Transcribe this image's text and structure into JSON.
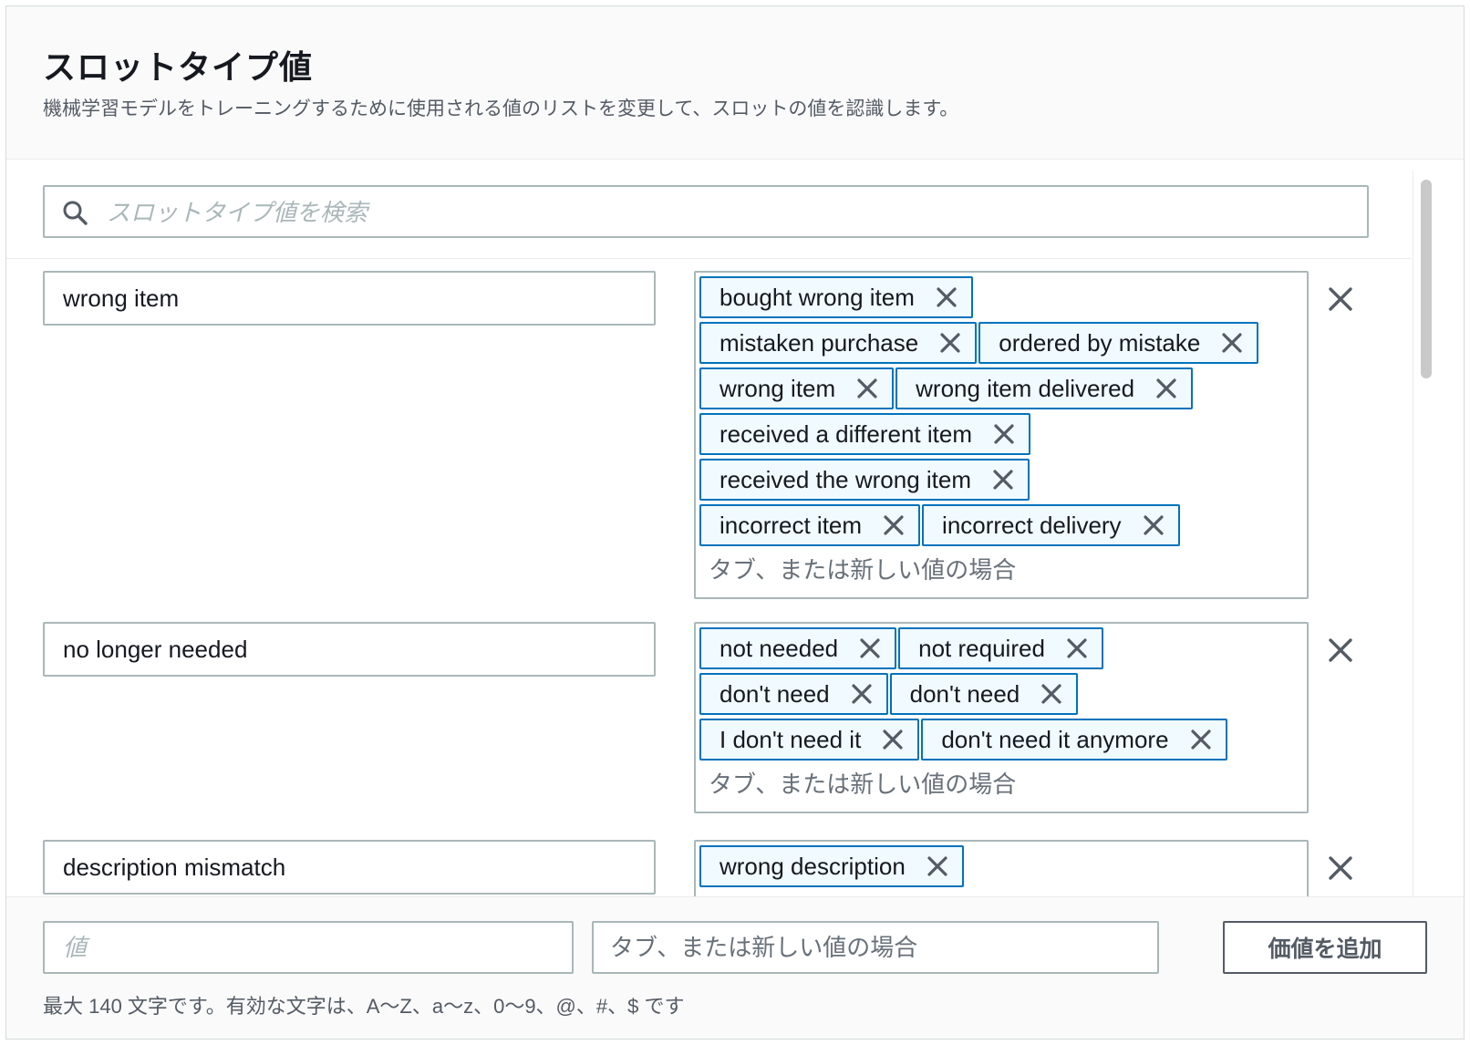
{
  "header": {
    "title": "スロットタイプ値",
    "description": "機械学習モデルをトレーニングするために使用される値のリストを変更して、スロットの値を認識します。"
  },
  "search": {
    "placeholder": "スロットタイプ値を検索",
    "icon": "search-icon"
  },
  "synonym_placeholder": "タブ、または新しい値の場合",
  "rows": [
    {
      "value": "wrong item",
      "synonym_lines": [
        [
          "bought wrong item"
        ],
        [
          "mistaken purchase",
          "ordered by mistake"
        ],
        [
          "wrong item",
          "wrong item delivered"
        ],
        [
          "received a different item"
        ],
        [
          "received the wrong item"
        ],
        [
          "incorrect item",
          "incorrect delivery"
        ]
      ]
    },
    {
      "value": "no longer needed",
      "synonym_lines": [
        [
          "not needed",
          "not required"
        ],
        [
          "don't need",
          "don't need"
        ],
        [
          "I don't need it",
          "don't need it anymore"
        ]
      ]
    },
    {
      "value": "description mismatch",
      "synonym_lines": [
        [
          "wrong description"
        ]
      ]
    }
  ],
  "footer": {
    "value_placeholder": "値",
    "synonym_placeholder": "タブ、または新しい値の場合",
    "add_button_label": "価値を追加",
    "hint": "最大 140 文字です。有効な文字は、A〜Z、a〜z、0〜9、@、#、$ です"
  },
  "colors": {
    "tag_border": "#0073bb",
    "tag_background": "#f1faff",
    "field_border": "#aab7b8",
    "header_background": "#fafafa"
  }
}
